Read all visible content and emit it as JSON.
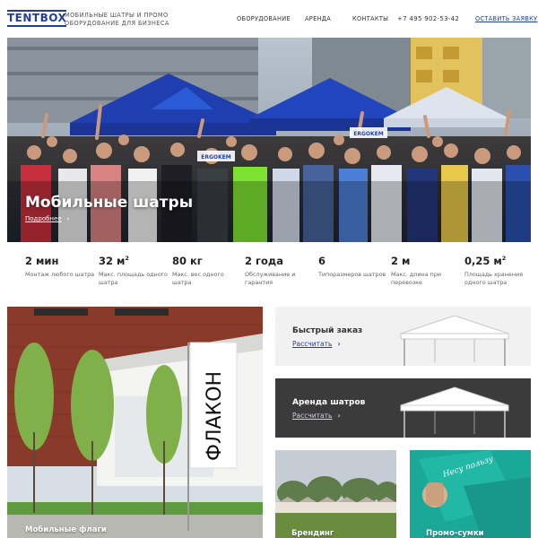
{
  "header": {
    "logo": "TENTBOX",
    "tagline": "МОБИЛЬНЫЕ ШАТРЫ И ПРОМО ОБОРУДОВАНИЕ ДЛЯ БИЗНЕСА",
    "nav": [
      "ОБОРУДОВАНИЕ",
      "АРЕНДА",
      "КОНТАКТЫ"
    ],
    "phone": "+7 495 902-53-42",
    "cta": "ОСТАВИТЬ ЗАЯВКУ"
  },
  "hero": {
    "title": "Мобильные шатры",
    "more": "Подробнее",
    "tent_banner_1": "ERGOKEM",
    "tent_banner_2": "ERGOKEM"
  },
  "stats": [
    {
      "value": "2 мин",
      "label": "Монтаж любого шатра"
    },
    {
      "value": "32 м",
      "sup": "2",
      "label": "Макс. площадь одного шатра"
    },
    {
      "value": "80 кг",
      "label": "Макс. вес одного шатра"
    },
    {
      "value": "2 года",
      "label": "Обслуживание и гарантия"
    },
    {
      "value": "6",
      "label": "Типоразмеров шатров"
    },
    {
      "value": "2 м",
      "label": "Макс. длина при перевозке"
    },
    {
      "value": "0,25 м",
      "sup": "2",
      "label": "Площадь хранения одного шатра"
    }
  ],
  "tiles": {
    "flags": {
      "title": "Мобильные флаги",
      "flag_text": "ФЛАКОН"
    },
    "quick": {
      "title": "Быстрый заказ",
      "link": "Рассчитать"
    },
    "rent": {
      "title": "Аренда шатров",
      "link": "Рассчитать"
    },
    "branding": {
      "title": "Брендинг"
    },
    "bags": {
      "title": "Промо-сумки",
      "bag_text": "Несу пользу"
    }
  },
  "colors": {
    "brand": "#1d3f9e",
    "tent_blue": "#1f3fb0",
    "rent_bg": "#3b3b3b",
    "bags_bg": "#1aa898"
  }
}
